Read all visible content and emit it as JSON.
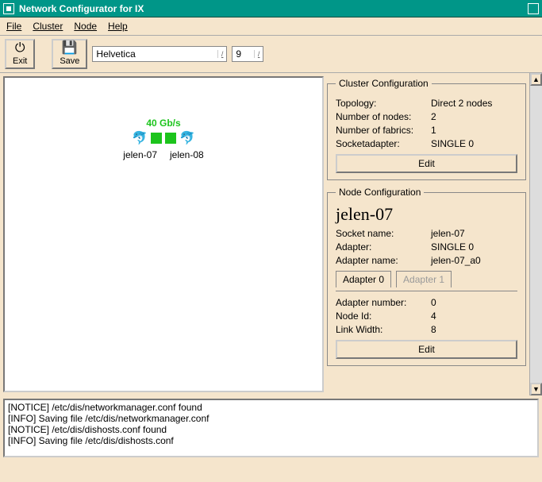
{
  "window": {
    "title": "Network Configurator for IX"
  },
  "menu": {
    "file": "File",
    "cluster": "Cluster",
    "node": "Node",
    "help": "Help"
  },
  "toolbar": {
    "exit": "Exit",
    "save": "Save",
    "font_name": "Helvetica",
    "font_size": "9"
  },
  "diagram": {
    "speed": "40 Gb/s",
    "node_a": "jelen-07",
    "node_b": "jelen-08"
  },
  "cluster": {
    "legend": "Cluster Configuration",
    "topology_k": "Topology:",
    "topology_v": "Direct 2 nodes",
    "nodes_k": "Number of nodes:",
    "nodes_v": "2",
    "fabrics_k": "Number of fabrics:",
    "fabrics_v": "1",
    "socket_k": "Socketadapter:",
    "socket_v": "SINGLE 0",
    "edit": "Edit"
  },
  "node": {
    "legend": "Node Configuration",
    "title": "jelen-07",
    "socket_k": "Socket name:",
    "socket_v": "jelen-07",
    "adapter_k": "Adapter:",
    "adapter_v": "SINGLE 0",
    "aname_k": "Adapter name:",
    "aname_v": "jelen-07_a0",
    "tab0": "Adapter 0",
    "tab1": "Adapter 1",
    "anum_k": "Adapter number:",
    "anum_v": "0",
    "nid_k": "Node Id:",
    "nid_v": "4",
    "lw_k": "Link Width:",
    "lw_v": "8",
    "edit": "Edit"
  },
  "log": {
    "l0": "[NOTICE] /etc/dis/networkmanager.conf found",
    "l1": "[INFO] Saving file /etc/dis/networkmanager.conf",
    "l2": "[NOTICE] /etc/dis/dishosts.conf found",
    "l3": "[INFO] Saving file /etc/dis/dishosts.conf"
  }
}
